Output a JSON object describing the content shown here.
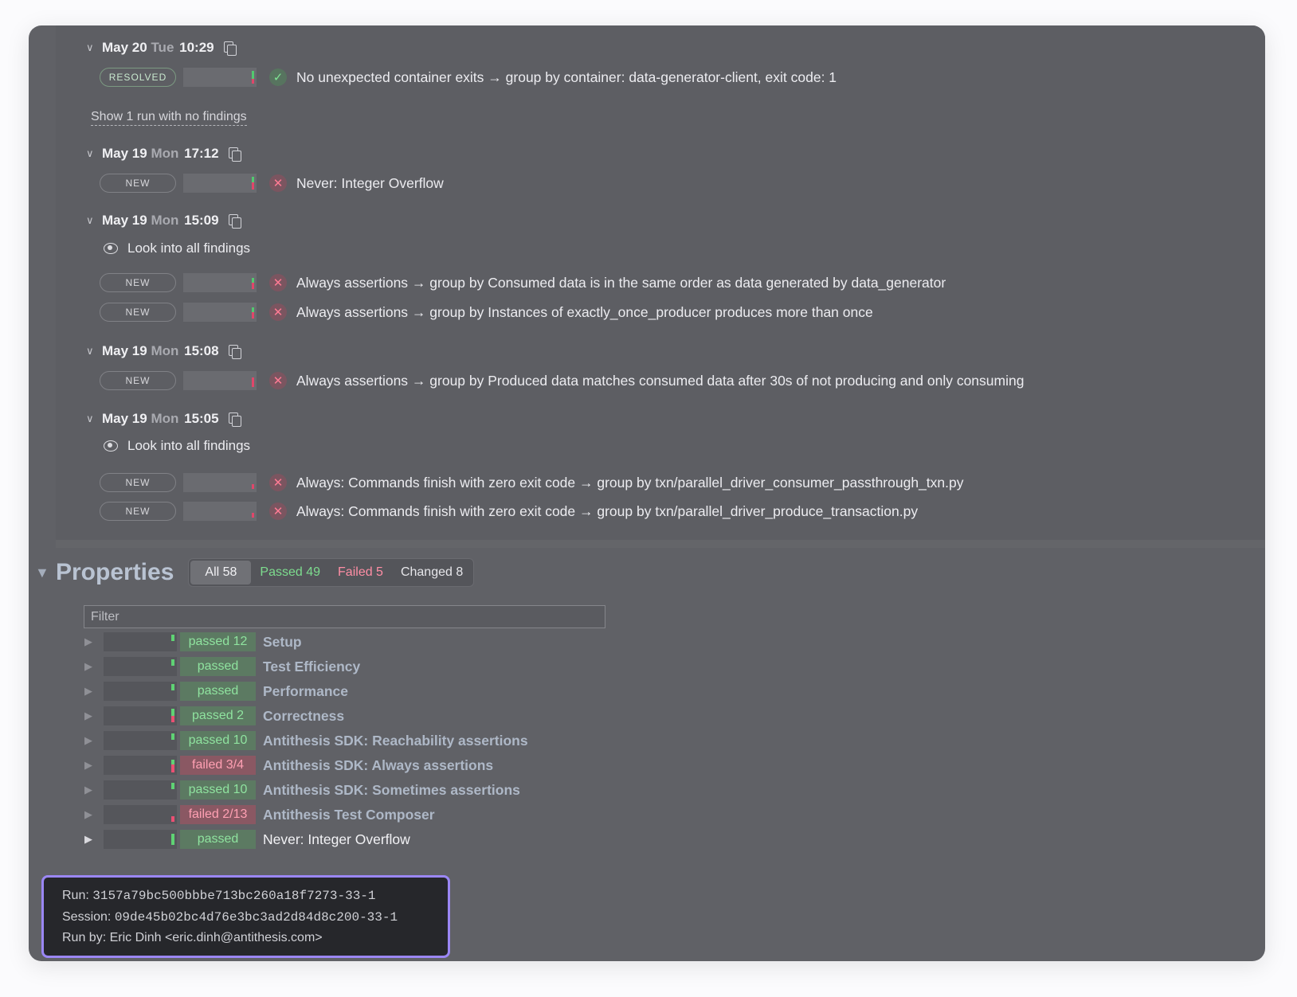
{
  "runs": [
    {
      "date": "May 20",
      "dow": "Tue",
      "time": "10:29",
      "findings": [
        {
          "status": "RESOLVED",
          "icon": "check-icon",
          "text": "No unexpected container exits → group by container: data-generator-client, exit code: 1"
        }
      ]
    },
    {
      "date": "May 19",
      "dow": "Mon",
      "time": "17:12",
      "findings": [
        {
          "status": "NEW",
          "icon": "x-icon",
          "text": "Never: Integer Overflow"
        }
      ]
    },
    {
      "date": "May 19",
      "dow": "Mon",
      "time": "15:09",
      "look_label": "Look into all findings",
      "findings": [
        {
          "status": "NEW",
          "icon": "x-icon",
          "text": "Always assertions → group by Consumed data is in the same order as data generated by data_generator"
        },
        {
          "status": "NEW",
          "icon": "x-icon",
          "text": "Always assertions → group by Instances of exactly_once_producer produces more than once"
        }
      ]
    },
    {
      "date": "May 19",
      "dow": "Mon",
      "time": "15:08",
      "findings": [
        {
          "status": "NEW",
          "icon": "x-icon",
          "text": "Always assertions → group by Produced data matches consumed data after 30s of not producing and only consuming"
        }
      ]
    },
    {
      "date": "May 19",
      "dow": "Mon",
      "time": "15:05",
      "look_label": "Look into all findings",
      "findings": [
        {
          "status": "NEW",
          "icon": "x-icon",
          "text": "Always: Commands finish with zero exit code → group by txn/parallel_driver_consumer_passthrough_txn.py"
        },
        {
          "status": "NEW",
          "icon": "x-icon",
          "text": "Always: Commands finish with zero exit code → group by txn/parallel_driver_produce_transaction.py"
        }
      ]
    }
  ],
  "show_no_findings_label": "Show 1 run with no findings",
  "properties": {
    "title": "Properties",
    "tabs": [
      {
        "label": "All 58",
        "kind": "active"
      },
      {
        "label": "Passed 49",
        "kind": "passed"
      },
      {
        "label": "Failed 5",
        "kind": "failed"
      },
      {
        "label": "Changed 8",
        "kind": "changed"
      }
    ],
    "filter_placeholder": "Filter",
    "rows": [
      {
        "status": "passed 12",
        "result": "ok",
        "name": "Setup"
      },
      {
        "status": "passed",
        "result": "ok",
        "name": "Test Efficiency"
      },
      {
        "status": "passed",
        "result": "ok",
        "name": "Performance"
      },
      {
        "status": "passed 2",
        "result": "ok",
        "name": "Correctness"
      },
      {
        "status": "passed 10",
        "result": "ok",
        "name": "Antithesis SDK: Reachability assertions"
      },
      {
        "status": "failed 3/4",
        "result": "bad",
        "name": "Antithesis SDK: Always assertions"
      },
      {
        "status": "passed 10",
        "result": "ok",
        "name": "Antithesis SDK: Sometimes assertions"
      },
      {
        "status": "failed 2/13",
        "result": "bad",
        "name": "Antithesis Test Composer"
      },
      {
        "status": "passed",
        "result": "ok",
        "name": "Never: Integer Overflow"
      }
    ]
  },
  "info": {
    "run_label": "Run:",
    "run_id": "3157a79bc500bbbe713bc260a18f7273-33-1",
    "session_label": "Session:",
    "session_id": "09de45b02bc4d76e3bc3ad2d84d8c200-33-1",
    "run_by": "Run by: Eric Dinh <eric.dinh@antithesis.com>"
  },
  "colors": {
    "accent_border": "#9b87f5",
    "pass": "#7ddc8e",
    "fail": "#ff8ea5"
  }
}
